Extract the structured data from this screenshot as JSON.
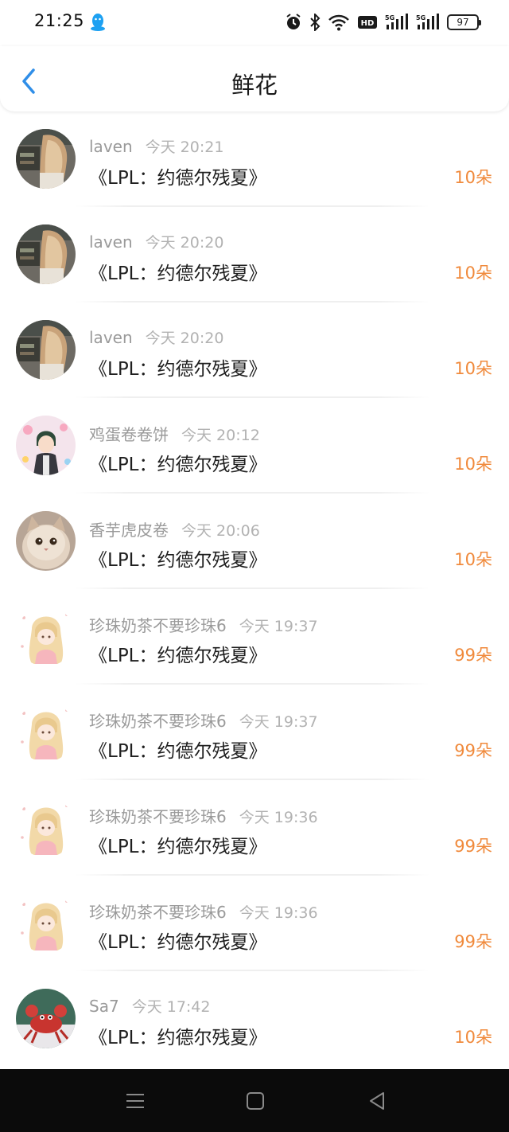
{
  "status_bar": {
    "time": "21:25",
    "icons": [
      "qq-icon",
      "alarm-icon",
      "bluetooth-icon",
      "wifi-icon",
      "hd-icon",
      "signal-5g-icon",
      "signal-5g-icon"
    ],
    "battery": "97"
  },
  "header": {
    "title": "鲜花",
    "back_icon": "chevron-left-icon"
  },
  "items": [
    {
      "user": "laven",
      "time": "今天 20:21",
      "title": "《LPL：约德尔残夏》",
      "count": "10朵",
      "avatar": "photo-girl"
    },
    {
      "user": "laven",
      "time": "今天 20:20",
      "title": "《LPL：约德尔残夏》",
      "count": "10朵",
      "avatar": "photo-girl"
    },
    {
      "user": "laven",
      "time": "今天 20:20",
      "title": "《LPL：约德尔残夏》",
      "count": "10朵",
      "avatar": "photo-girl"
    },
    {
      "user": "鸡蛋卷卷饼",
      "time": "今天 20:12",
      "title": "《LPL：约德尔残夏》",
      "count": "10朵",
      "avatar": "anime-boy"
    },
    {
      "user": "香芋虎皮卷",
      "time": "今天 20:06",
      "title": "《LPL：约德尔残夏》",
      "count": "10朵",
      "avatar": "cat"
    },
    {
      "user": "珍珠奶茶不要珍珠6",
      "time": "今天 19:37",
      "title": "《LPL：约德尔残夏》",
      "count": "99朵",
      "avatar": "anime-girl"
    },
    {
      "user": "珍珠奶茶不要珍珠6",
      "time": "今天 19:37",
      "title": "《LPL：约德尔残夏》",
      "count": "99朵",
      "avatar": "anime-girl"
    },
    {
      "user": "珍珠奶茶不要珍珠6",
      "time": "今天 19:36",
      "title": "《LPL：约德尔残夏》",
      "count": "99朵",
      "avatar": "anime-girl"
    },
    {
      "user": "珍珠奶茶不要珍珠6",
      "time": "今天 19:36",
      "title": "《LPL：约德尔残夏》",
      "count": "99朵",
      "avatar": "anime-girl"
    },
    {
      "user": "Sa7",
      "time": "今天 17:42",
      "title": "《LPL：约德尔残夏》",
      "count": "10朵",
      "avatar": "crab"
    }
  ],
  "colors": {
    "accent": "#2f8ee8",
    "count": "#f08a3c",
    "meta": "#9a9a9a",
    "navbar": "#0b0b0b"
  },
  "navbar": {
    "buttons": [
      "menu-icon",
      "home-icon",
      "back-triangle-icon"
    ]
  }
}
